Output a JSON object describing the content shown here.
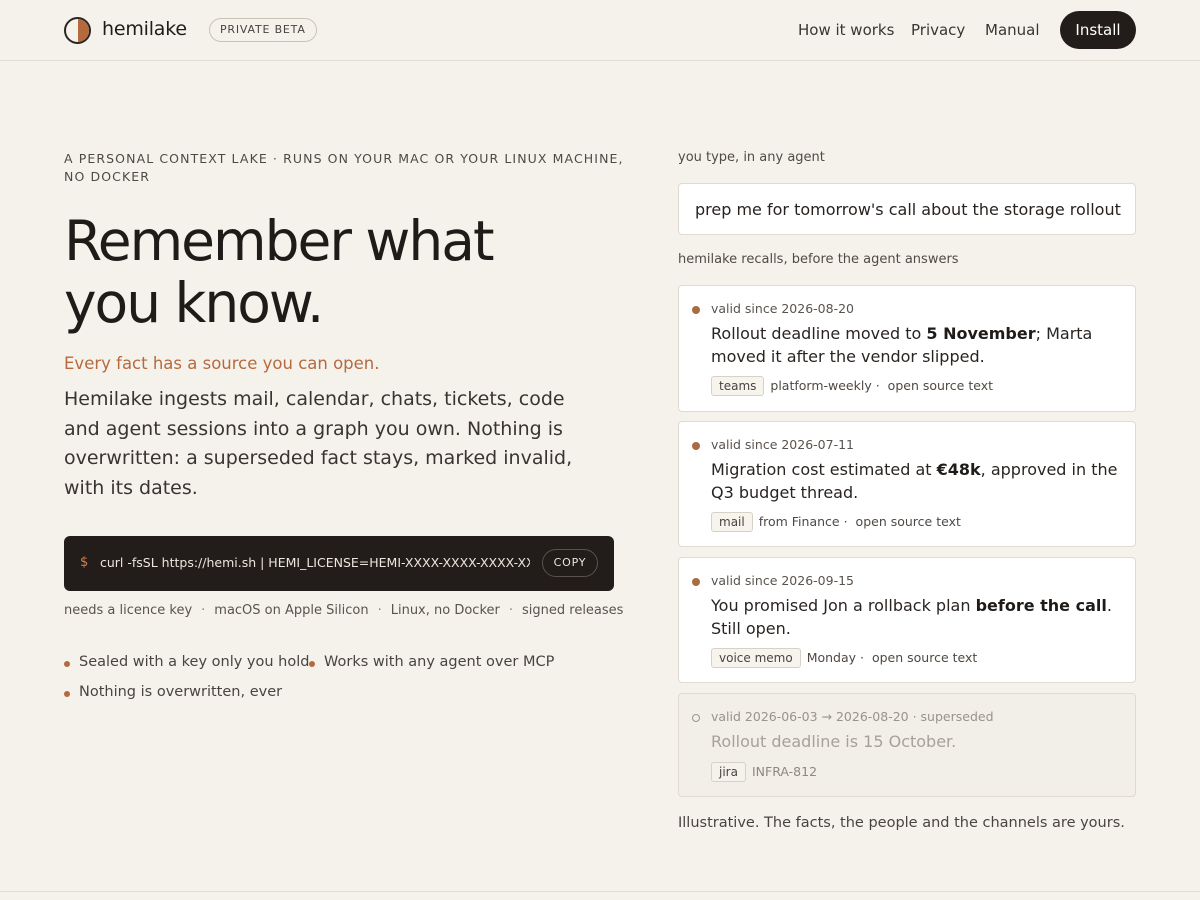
{
  "header": {
    "brand": "hemilake",
    "badge": "PRIVATE BETA",
    "nav": [
      "How it works",
      "Privacy",
      "Manual"
    ],
    "cta": "Install"
  },
  "hero": {
    "eyebrow": "A PERSONAL CONTEXT LAKE · RUNS ON YOUR MAC OR YOUR LINUX MACHINE, NO DOCKER",
    "headline_line1": "Remember what",
    "headline_line2": "you know.",
    "tagline": "Every fact has a source you can open.",
    "intro": "Hemilake ingests mail, calendar, chats, tickets, code and agent sessions into a graph you own. Nothing is overwritten: a superseded fact stays, marked invalid, with its dates.",
    "terminal": {
      "prompt": "$",
      "command": "curl -fsSL https://hemi.sh | HEMI_LICENSE=HEMI-XXXX-XXXX-XXXX-XXXX bash",
      "copy_label": "COPY"
    },
    "requirements": [
      "needs a licence key",
      "macOS on Apple Silicon",
      "Linux, no Docker",
      "signed releases"
    ],
    "features": [
      "Sealed with a key only you hold",
      "Works with any agent over MCP",
      "Nothing is overwritten, ever"
    ]
  },
  "demo": {
    "type_label": "you type, in any agent",
    "query": "prep me for tomorrow's call about the storage rollout",
    "recall_label": "hemilake recalls, before the agent answers",
    "cards": [
      {
        "valid": "valid since 2026-08-20",
        "fact_pre": "Rollout deadline moved to ",
        "fact_bold": "5 November",
        "fact_post": "; Marta moved it after the vendor slipped.",
        "chip": "teams",
        "source": "platform-weekly ·",
        "open": "open source text"
      },
      {
        "valid": "valid since 2026-07-11",
        "fact_pre": "Migration cost estimated at ",
        "fact_bold": "€48k",
        "fact_post": ", approved in the Q3 budget thread.",
        "chip": "mail",
        "source": "from Finance ·",
        "open": "open source text"
      },
      {
        "valid": "valid since 2026-09-15",
        "fact_pre": "You promised Jon a rollback plan ",
        "fact_bold": "before the call",
        "fact_post": ". Still open.",
        "chip": "voice memo",
        "source": "Monday ·",
        "open": "open source text"
      },
      {
        "valid": "valid 2026-06-03 → 2026-08-20 · superseded",
        "fact": "Rollout deadline is 15 October.",
        "chip": "jira",
        "source": "INFRA-812"
      }
    ],
    "footnote": "Illustrative. The facts, the people and the channels are yours."
  },
  "colors": {
    "accent": "#b56a3e",
    "background": "#f5f2ec",
    "dark": "#221d1a"
  }
}
